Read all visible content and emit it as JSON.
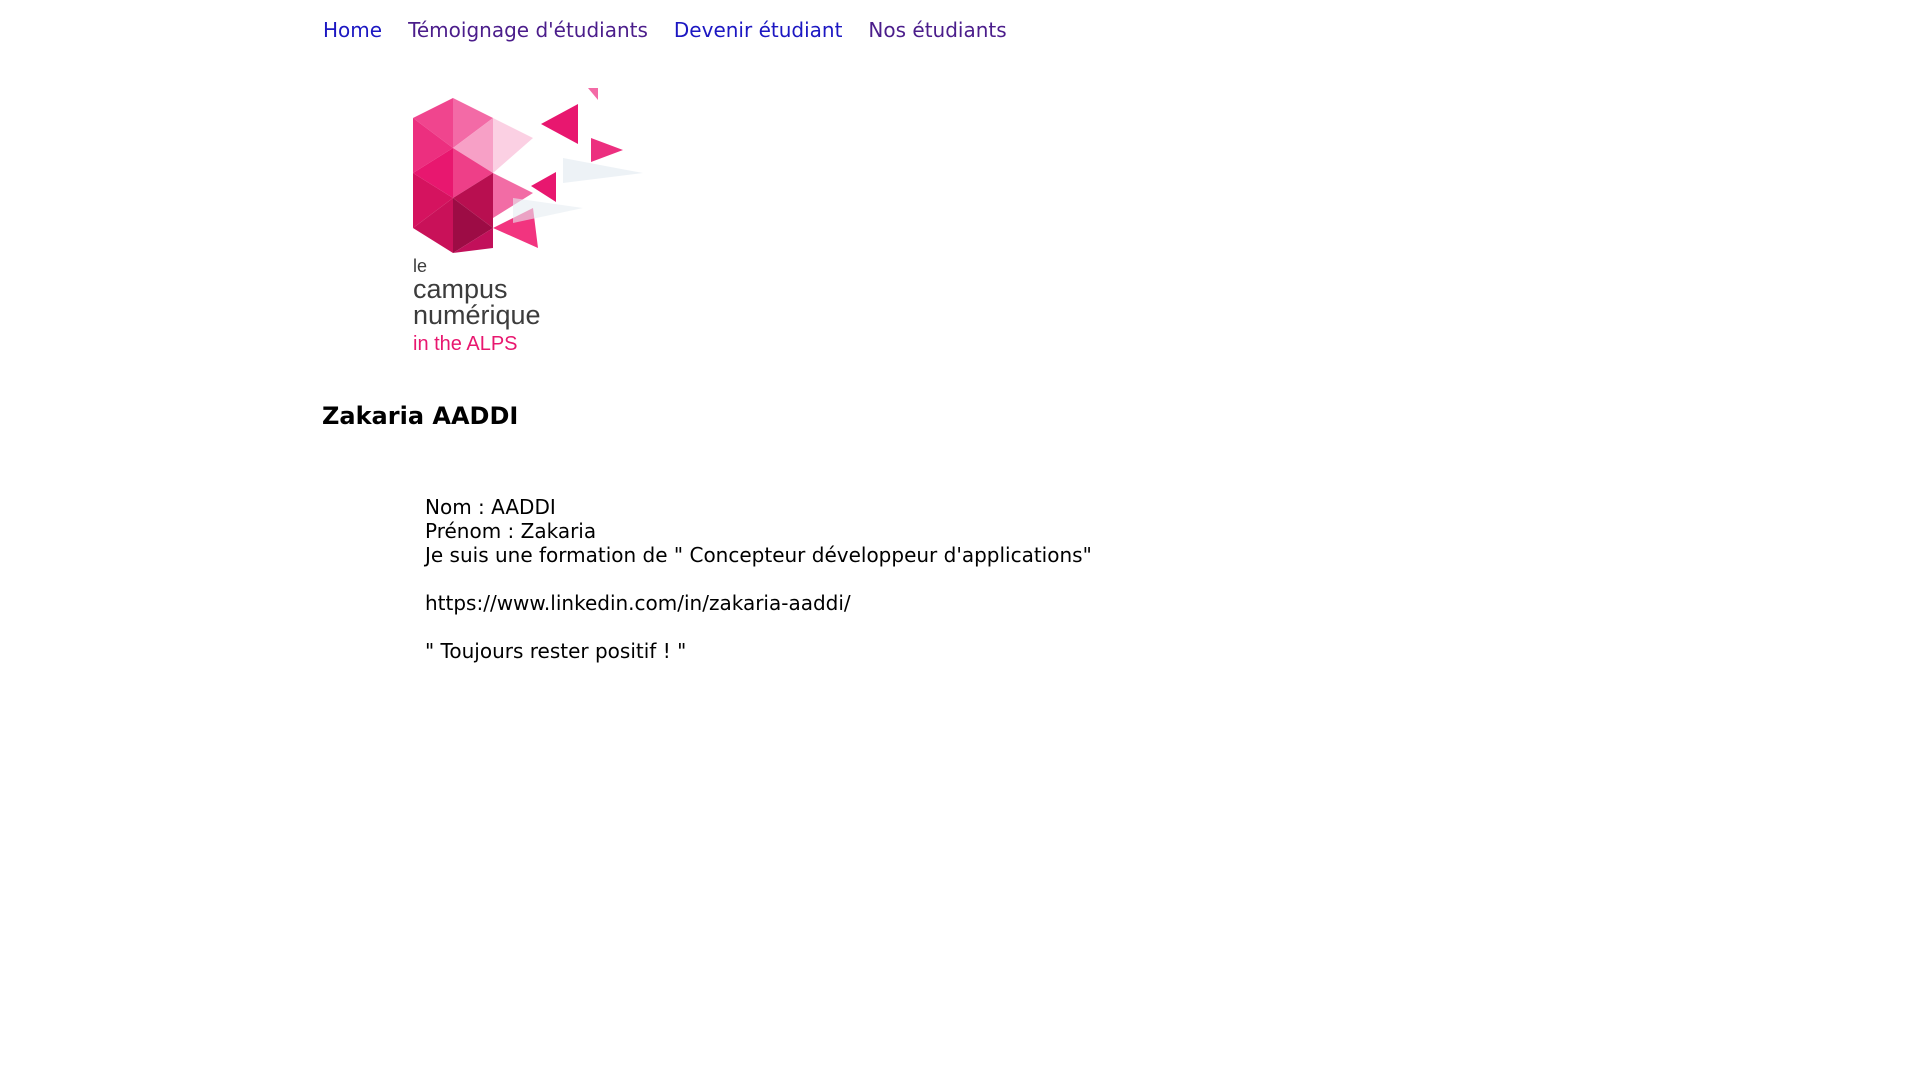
{
  "nav": {
    "items": [
      {
        "label": "Home",
        "visited": false
      },
      {
        "label": "Témoignage d'étudiants",
        "visited": true
      },
      {
        "label": "Devenir étudiant",
        "visited": false
      },
      {
        "label": "Nos étudiants",
        "visited": true
      }
    ]
  },
  "logo": {
    "line1": "le",
    "line2": "campus",
    "line3": "numérique",
    "line4": "in the ALPS",
    "colors": {
      "brand_pink": "#e8176f",
      "brand_dark": "#3c3c3c"
    }
  },
  "student": {
    "name": "Zakaria AADDI",
    "nom_line": "Nom : AADDI",
    "prenom_line": "Prénom : Zakaria",
    "formation_line": "Je suis une formation de \" Concepteur développeur d'applications\"",
    "linkedin": "https://www.linkedin.com/in/zakaria-aaddi/",
    "quote": "\" Toujours rester positif ! \""
  }
}
